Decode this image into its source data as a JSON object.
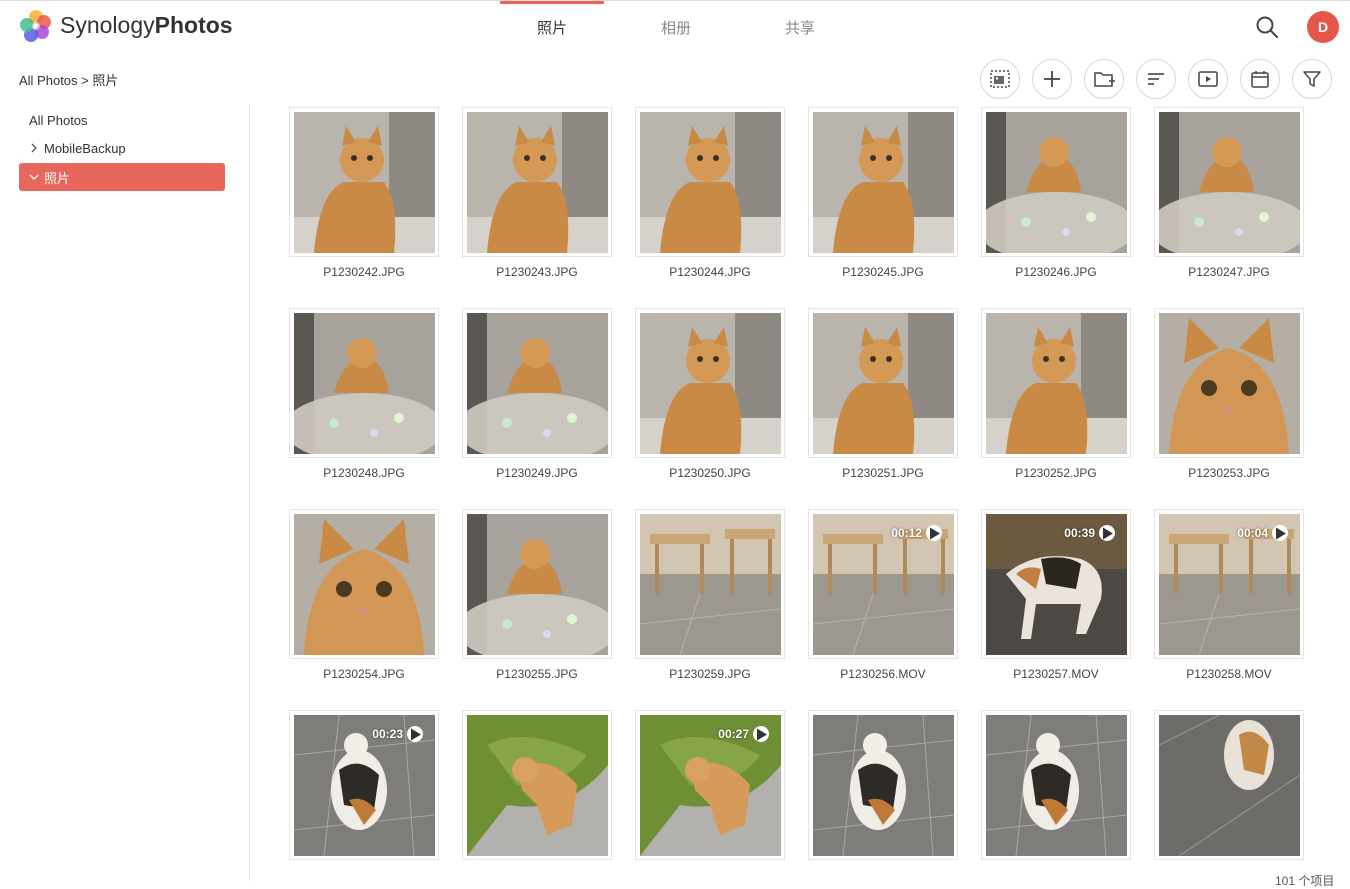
{
  "brand": {
    "name_light": "Synology",
    "name_bold": "Photos"
  },
  "tabs": [
    {
      "label": "照片",
      "active": true
    },
    {
      "label": "相册",
      "active": false
    },
    {
      "label": "共享",
      "active": false
    }
  ],
  "user": {
    "initial": "D",
    "color": "#e5574b"
  },
  "breadcrumb": "All Photos > 照片",
  "toolbar": [
    "select-icon",
    "add-icon",
    "new-folder-icon",
    "sort-icon",
    "slideshow-icon",
    "calendar-icon",
    "filter-icon"
  ],
  "sidebar": {
    "items": [
      {
        "label": "All Photos"
      },
      {
        "label": "MobileBackup"
      },
      {
        "label": "照片"
      }
    ]
  },
  "photos": [
    {
      "name": "P1230242.JPG",
      "scene": "kitten",
      "duration": ""
    },
    {
      "name": "P1230243.JPG",
      "scene": "kitten",
      "duration": ""
    },
    {
      "name": "P1230244.JPG",
      "scene": "kitten",
      "duration": ""
    },
    {
      "name": "P1230245.JPG",
      "scene": "kitten",
      "duration": ""
    },
    {
      "name": "P1230246.JPG",
      "scene": "kitten-blur",
      "duration": ""
    },
    {
      "name": "P1230247.JPG",
      "scene": "kitten-blur",
      "duration": ""
    },
    {
      "name": "P1230248.JPG",
      "scene": "kitten-blur",
      "duration": ""
    },
    {
      "name": "P1230249.JPG",
      "scene": "kitten-blur",
      "duration": ""
    },
    {
      "name": "P1230250.JPG",
      "scene": "kitten",
      "duration": ""
    },
    {
      "name": "P1230251.JPG",
      "scene": "kitten",
      "duration": ""
    },
    {
      "name": "P1230252.JPG",
      "scene": "kitten",
      "duration": ""
    },
    {
      "name": "P1230253.JPG",
      "scene": "kitten-close",
      "duration": ""
    },
    {
      "name": "P1230254.JPG",
      "scene": "kitten-close",
      "duration": ""
    },
    {
      "name": "P1230255.JPG",
      "scene": "kitten-blur",
      "duration": ""
    },
    {
      "name": "P1230259.JPG",
      "scene": "room",
      "duration": ""
    },
    {
      "name": "P1230256.MOV",
      "scene": "room",
      "duration": "00:12"
    },
    {
      "name": "P1230257.MOV",
      "scene": "calico-dark",
      "duration": "00:39"
    },
    {
      "name": "P1230258.MOV",
      "scene": "room",
      "duration": "00:04"
    },
    {
      "name": "",
      "scene": "calico-floor",
      "duration": "00:23"
    },
    {
      "name": "",
      "scene": "green-bag",
      "duration": ""
    },
    {
      "name": "",
      "scene": "green-bag",
      "duration": "00:27"
    },
    {
      "name": "",
      "scene": "calico-floor",
      "duration": ""
    },
    {
      "name": "",
      "scene": "calico-floor",
      "duration": ""
    },
    {
      "name": "",
      "scene": "floor",
      "duration": ""
    }
  ],
  "item_count": "101 个项目",
  "colors": {
    "accent": "#e8675d"
  }
}
